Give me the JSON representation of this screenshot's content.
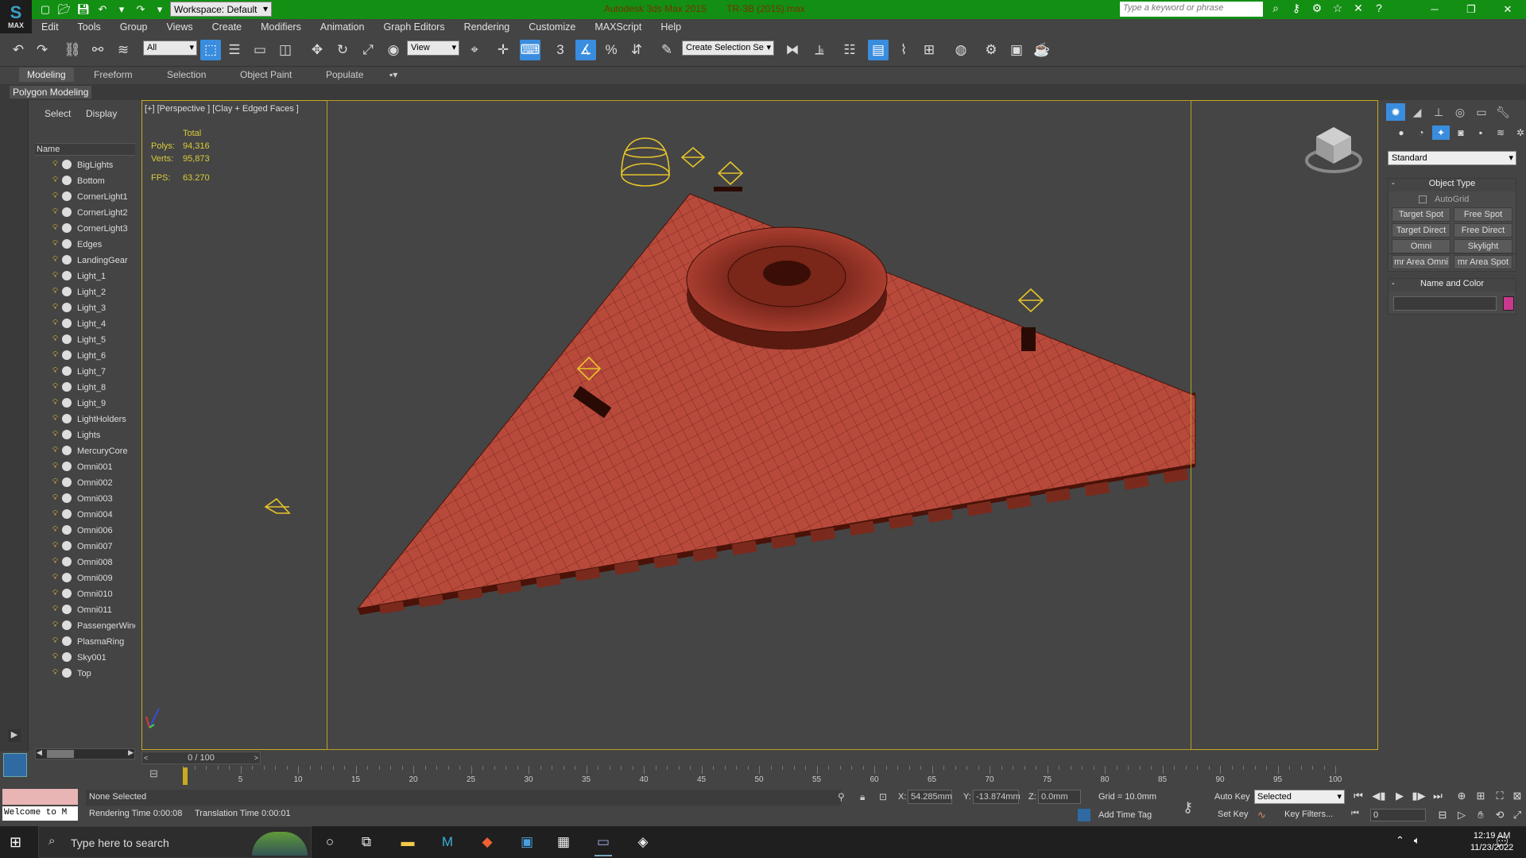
{
  "titlebar": {
    "logo_text": "MAX",
    "workspace": "Workspace: Default",
    "app_name": "Autodesk 3ds Max  2015",
    "file_name": "TR-3B (2015).max",
    "search_placeholder": "Type a keyword or phrase"
  },
  "menu": [
    "Edit",
    "Tools",
    "Group",
    "Views",
    "Create",
    "Modifiers",
    "Animation",
    "Graph Editors",
    "Rendering",
    "Customize",
    "MAXScript",
    "Help"
  ],
  "toolbar": {
    "selection_filter": "All",
    "ref_coord": "View",
    "named_selection": "Create Selection Se",
    "snap_3": "3"
  },
  "ribbon": {
    "tabs": [
      "Modeling",
      "Freeform",
      "Selection",
      "Object Paint",
      "Populate"
    ],
    "active_tab": "Modeling",
    "panel": "Polygon Modeling"
  },
  "explorer": {
    "tabs": [
      "Select",
      "Display"
    ],
    "column_header": "Name",
    "items": [
      "BigLights",
      "Bottom",
      "CornerLight1",
      "CornerLight2",
      "CornerLight3",
      "Edges",
      "LandingGear",
      "Light_1",
      "Light_2",
      "Light_3",
      "Light_4",
      "Light_5",
      "Light_6",
      "Light_7",
      "Light_8",
      "Light_9",
      "LightHolders",
      "Lights",
      "MercuryCore",
      "Omni001",
      "Omni002",
      "Omni003",
      "Omni004",
      "Omni006",
      "Omni007",
      "Omni008",
      "Omni009",
      "Omni010",
      "Omni011",
      "PassengerWindows",
      "PlasmaRing",
      "Sky001",
      "Top"
    ]
  },
  "viewport": {
    "label": "[+] [Perspective ] [Clay + Edged Faces ]",
    "stats_header": "Total",
    "polys_label": "Polys:",
    "polys": "94,316",
    "verts_label": "Verts:",
    "verts": "95,873",
    "fps_label": "FPS:",
    "fps": "63.270"
  },
  "command_panel": {
    "category": "Standard",
    "object_type_title": "Object Type",
    "autogrid": "AutoGrid",
    "buttons": [
      "Target Spot",
      "Free Spot",
      "Target Direct",
      "Free Direct",
      "Omni",
      "Skylight",
      "mr Area Omni",
      "mr Area Spot"
    ],
    "name_color_title": "Name and Color",
    "object_color": "#c8388c"
  },
  "timeline": {
    "frame_display": "0 / 100",
    "ticks": [
      "5",
      "10",
      "15",
      "20",
      "25",
      "30",
      "35",
      "40",
      "45",
      "50",
      "55",
      "60",
      "65",
      "70",
      "75",
      "80",
      "85",
      "90",
      "95",
      "100"
    ]
  },
  "status": {
    "maxscript_output": "Welcome to M",
    "selection": "None Selected",
    "rendering_time": "Rendering Time  0:00:08",
    "translation_time": "Translation Time  0:00:01",
    "x_label": "X:",
    "x": "54.285mm",
    "y_label": "Y:",
    "y": "-13.874mm",
    "z_label": "Z:",
    "z": "0.0mm",
    "grid": "Grid = 10.0mm",
    "add_time_tag": "Add Time Tag",
    "auto_key": "Auto Key",
    "set_key": "Set Key",
    "key_mode": "Selected",
    "key_filters": "Key Filters...",
    "current_frame": "0"
  },
  "taskbar": {
    "search_text": "Type here to search",
    "time": "12:19 AM",
    "date": "11/23/2022"
  },
  "colors": {
    "titlebar": "#138f14",
    "active_button": "#3a8dde",
    "model_fill": "#b84a3c",
    "wire": "#6a1e14",
    "light_gizmo": "#e6c42a",
    "safe_frame": "#b89e28"
  }
}
